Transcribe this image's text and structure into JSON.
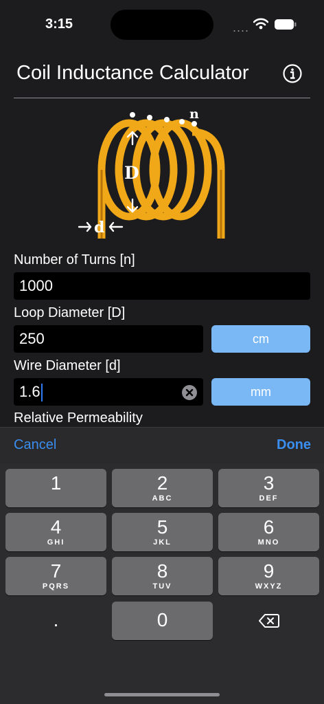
{
  "status_bar": {
    "time": "3:15",
    "signal": "...."
  },
  "header": {
    "title": "Coil Inductance Calculator"
  },
  "diagram": {
    "turns_label": "n",
    "loop_label": "D",
    "wire_label": "d"
  },
  "form": {
    "turns": {
      "label": "Number of Turns [n]",
      "value": "1000"
    },
    "loop": {
      "label": "Loop Diameter [D]",
      "value": "250",
      "unit": "cm"
    },
    "wire": {
      "label": "Wire Diameter [d]",
      "value": "1.6",
      "unit": "mm"
    },
    "permeability": {
      "label": "Relative Permeability"
    }
  },
  "toolbar": {
    "cancel": "Cancel",
    "done": "Done"
  },
  "keyboard": {
    "keys": [
      {
        "digit": "1",
        "letters": ""
      },
      {
        "digit": "2",
        "letters": "ABC"
      },
      {
        "digit": "3",
        "letters": "DEF"
      },
      {
        "digit": "4",
        "letters": "GHI"
      },
      {
        "digit": "5",
        "letters": "JKL"
      },
      {
        "digit": "6",
        "letters": "MNO"
      },
      {
        "digit": "7",
        "letters": "PQRS"
      },
      {
        "digit": "8",
        "letters": "TUV"
      },
      {
        "digit": "9",
        "letters": "WXYZ"
      },
      {
        "digit": ".",
        "letters": ""
      },
      {
        "digit": "0",
        "letters": ""
      }
    ]
  },
  "colors": {
    "accent": "#3a8eef",
    "unit_button": "#7ab8f5",
    "coil": "#f0a818",
    "background": "#1c1c1e"
  }
}
